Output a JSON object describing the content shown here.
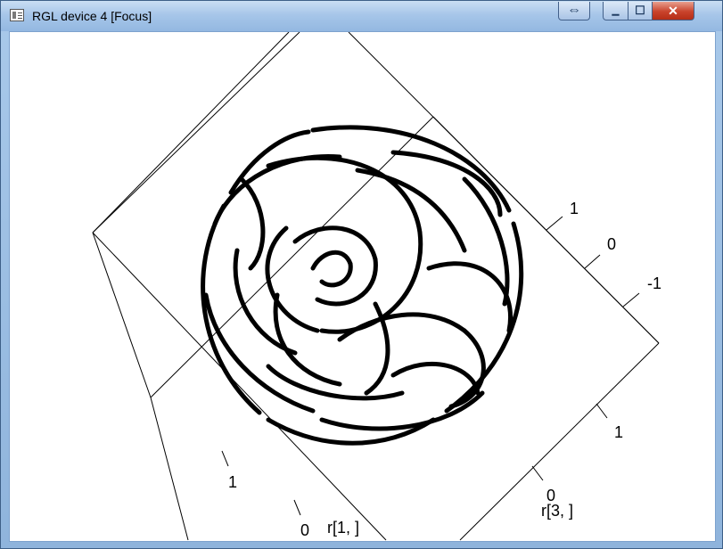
{
  "window": {
    "title": "RGL device 4 [Focus]",
    "controls": {
      "restore_symbol": "⇔",
      "minimize_symbol": "▁",
      "maximize_symbol": "☐",
      "close_symbol": "✕"
    }
  },
  "plot": {
    "axis_x_label": "r[1, ]",
    "axis_z_label": "r[3, ]",
    "x_ticks": [
      "1",
      "0"
    ],
    "z_ticks": [
      "1",
      "0"
    ],
    "y_ticks": [
      "1",
      "0",
      "-1"
    ],
    "curve_color": "#000000",
    "box_color": "#000000"
  }
}
